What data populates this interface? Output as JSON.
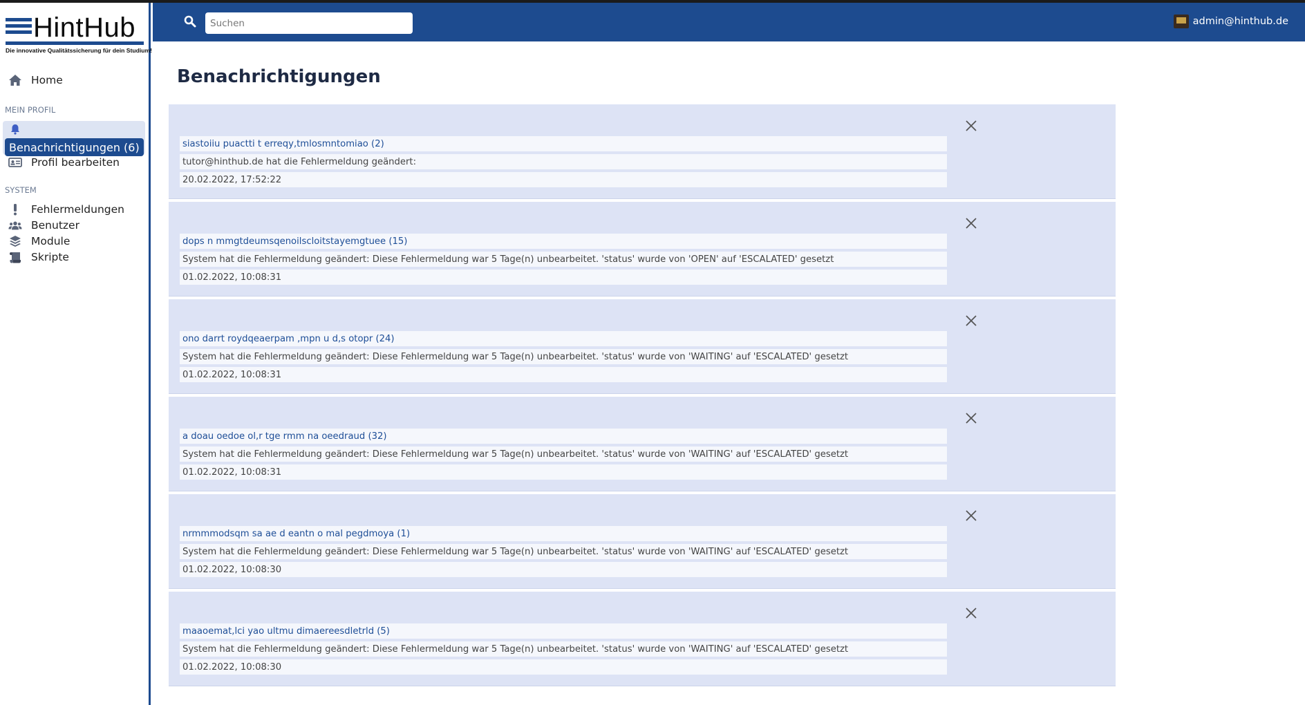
{
  "app": {
    "logo_text": "HintHub",
    "tagline": "Die innovative Qualitätssicherung für dein Studium!"
  },
  "sidebar": {
    "home_label": "Home",
    "section_profile": "MEIN PROFIL",
    "notifications_label": "Benachrichtigungen (6)",
    "edit_profile_label": "Profil bearbeiten",
    "section_system": "SYSTEM",
    "items": [
      {
        "label": "Fehlermeldungen",
        "icon": "exclamation-icon"
      },
      {
        "label": "Benutzer",
        "icon": "users-icon"
      },
      {
        "label": "Module",
        "icon": "layers-icon"
      },
      {
        "label": "Skripte",
        "icon": "scroll-icon"
      }
    ]
  },
  "topbar": {
    "search_placeholder": "Suchen",
    "user_email": "admin@hinthub.de"
  },
  "main": {
    "title": "Benachrichtigungen",
    "notifications": [
      {
        "title": "siastoiiu puactti t erreqy,tmlosmntomiao (2)",
        "message": "tutor@hinthub.de hat die Fehlermeldung geändert:",
        "date": "20.02.2022, 17:52:22"
      },
      {
        "title": "dops n mmgtdeumsqenoilscloitstayemgtuee (15)",
        "message": "System hat die Fehlermeldung geändert: Diese Fehlermeldung war 5 Tage(n) unbearbeitet. 'status' wurde von 'OPEN' auf 'ESCALATED' gesetzt",
        "date": "01.02.2022, 10:08:31"
      },
      {
        "title": "ono darrt roydqeaerpam ,mpn u d,s otopr (24)",
        "message": "System hat die Fehlermeldung geändert: Diese Fehlermeldung war 5 Tage(n) unbearbeitet. 'status' wurde von 'WAITING' auf 'ESCALATED' gesetzt",
        "date": "01.02.2022, 10:08:31"
      },
      {
        "title": "a doau oedoe ol,r tge rmm na oeedraud (32)",
        "message": "System hat die Fehlermeldung geändert: Diese Fehlermeldung war 5 Tage(n) unbearbeitet. 'status' wurde von 'WAITING' auf 'ESCALATED' gesetzt",
        "date": "01.02.2022, 10:08:31"
      },
      {
        "title": "nrmmmodsqm sa ae d eantn o mal pegdmoya (1)",
        "message": "System hat die Fehlermeldung geändert: Diese Fehlermeldung war 5 Tage(n) unbearbeitet. 'status' wurde von 'WAITING' auf 'ESCALATED' gesetzt",
        "date": "01.02.2022, 10:08:30"
      },
      {
        "title": "maaoemat,lci yao ultmu dimaereesdletrld (5)",
        "message": "System hat die Fehlermeldung geändert: Diese Fehlermeldung war 5 Tage(n) unbearbeitet. 'status' wurde von 'WAITING' auf 'ESCALATED' gesetzt",
        "date": "01.02.2022, 10:08:30"
      }
    ]
  },
  "colors": {
    "brand": "#1d4b8f",
    "card_bg": "#dde3f5",
    "link": "#1e4e97"
  }
}
